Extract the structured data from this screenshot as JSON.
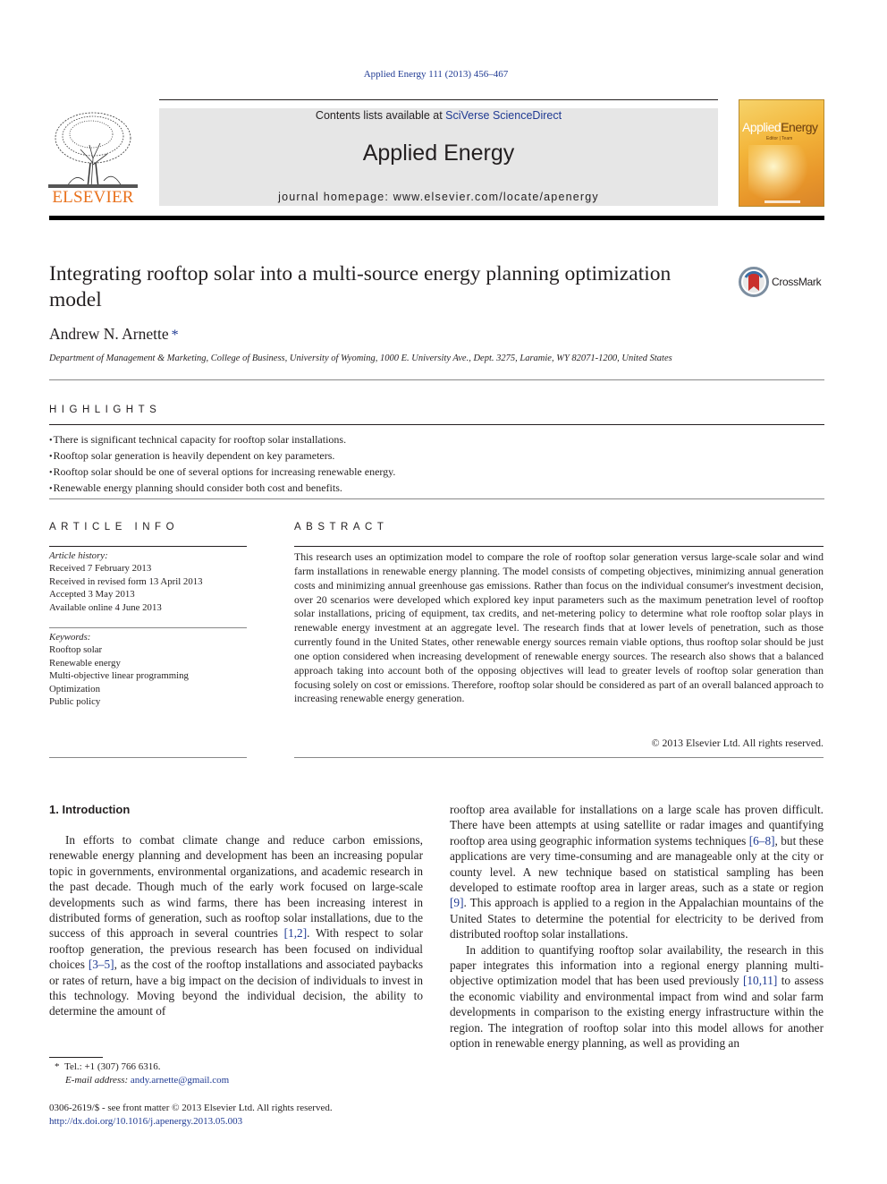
{
  "header": {
    "journal_ref": "Applied Energy 111 (2013) 456–467",
    "contents_prefix": "Contents lists available at ",
    "contents_link": "SciVerse ScienceDirect",
    "journal_title": "Applied Energy",
    "homepage_prefix": "journal homepage: ",
    "homepage_url": "www.elsevier.com/locate/apenergy",
    "publisher_logo_text": "ELSEVIER",
    "cover_title_a": "Applied",
    "cover_title_b": "Energy",
    "cover_sub": "Editor | Team"
  },
  "article": {
    "title": "Integrating rooftop solar into a multi-source energy planning optimization model",
    "crossmark_label": "CrossMark",
    "author": "Andrew N. Arnette",
    "author_mark": "*",
    "affiliation": "Department of Management & Marketing, College of Business, University of Wyoming, 1000 E. University Ave., Dept. 3275, Laramie, WY 82071-1200, United States"
  },
  "highlights": {
    "heading": "HIGHLIGHTS",
    "items": [
      "There is significant technical capacity for rooftop solar installations.",
      "Rooftop solar generation is heavily dependent on key parameters.",
      "Rooftop solar should be one of several options for increasing renewable energy.",
      "Renewable energy planning should consider both cost and benefits."
    ]
  },
  "article_info": {
    "heading": "ARTICLE INFO",
    "history_label": "Article history:",
    "history": [
      "Received 7 February 2013",
      "Received in revised form 13 April 2013",
      "Accepted 3 May 2013",
      "Available online 4 June 2013"
    ],
    "keywords_label": "Keywords:",
    "keywords": [
      "Rooftop solar",
      "Renewable energy",
      "Multi-objective linear programming",
      "Optimization",
      "Public policy"
    ]
  },
  "abstract": {
    "heading": "ABSTRACT",
    "text": "This research uses an optimization model to compare the role of rooftop solar generation versus large-scale solar and wind farm installations in renewable energy planning. The model consists of competing objectives, minimizing annual generation costs and minimizing annual greenhouse gas emissions. Rather than focus on the individual consumer's investment decision, over 20 scenarios were developed which explored key input parameters such as the maximum penetration level of rooftop solar installations, pricing of equipment, tax credits, and net-metering policy to determine what role rooftop solar plays in renewable energy investment at an aggregate level. The research finds that at lower levels of penetration, such as those currently found in the United States, other renewable energy sources remain viable options, thus rooftop solar should be just one option considered when increasing development of renewable energy sources. The research also shows that a balanced approach taking into account both of the opposing objectives will lead to greater levels of rooftop solar generation than focusing solely on cost or emissions. Therefore, rooftop solar should be considered as part of an overall balanced approach to increasing renewable energy generation.",
    "copyright": "© 2013 Elsevier Ltd. All rights reserved."
  },
  "intro": {
    "heading": "1. Introduction",
    "col1": [
      {
        "parts": [
          {
            "t": "In efforts to combat climate change and reduce carbon emissions, renewable energy planning and development has been an increasing popular topic in governments, environmental organizations, and academic research in the past decade. Though much of the early work focused on large-scale developments such as wind farms, there has been increasing interest in distributed forms of generation, such as rooftop solar installations, due to the success of this approach in several countries "
          },
          {
            "ref": "[1,2]"
          },
          {
            "t": ". With respect to solar rooftop generation, the previous research has been focused on individual choices "
          },
          {
            "ref": "[3–5]"
          },
          {
            "t": ", as the cost of the rooftop installations and associated paybacks or rates of return, have a big impact on the decision of individuals to invest in this technology. Moving beyond the individual decision, the ability to determine the amount of"
          }
        ]
      }
    ],
    "col2": [
      {
        "noindent": true,
        "parts": [
          {
            "t": "rooftop area available for installations on a large scale has proven difficult. There have been attempts at using satellite or radar images and quantifying rooftop area using geographic information systems techniques "
          },
          {
            "ref": "[6–8]"
          },
          {
            "t": ", but these applications are very time-consuming and are manageable only at the city or county level. A new technique based on statistical sampling has been developed to estimate rooftop area in larger areas, such as a state or region "
          },
          {
            "ref": "[9]"
          },
          {
            "t": ". This approach is applied to a region in the Appalachian mountains of the United States to determine the potential for electricity to be derived from distributed rooftop solar installations."
          }
        ]
      },
      {
        "parts": [
          {
            "t": "In addition to quantifying rooftop solar availability, the research in this paper integrates this information into a regional energy planning multi-objective optimization model that has been used previously "
          },
          {
            "ref": "[10,11]"
          },
          {
            "t": " to assess the economic viability and environmental impact from wind and solar farm developments in comparison to the existing energy infrastructure within the region. The integration of rooftop solar into this model allows for another option in renewable energy planning, as well as providing an"
          }
        ]
      }
    ]
  },
  "footnote": {
    "mark": "*",
    "tel": "Tel.: +1 (307) 766 6316.",
    "email_label": "E-mail address:",
    "email": "andy.arnette@gmail.com"
  },
  "bottom": {
    "issn": "0306-2619/$ - see front matter © 2013 Elsevier Ltd. All rights reserved.",
    "doi": "http://dx.doi.org/10.1016/j.apenergy.2013.05.003"
  }
}
